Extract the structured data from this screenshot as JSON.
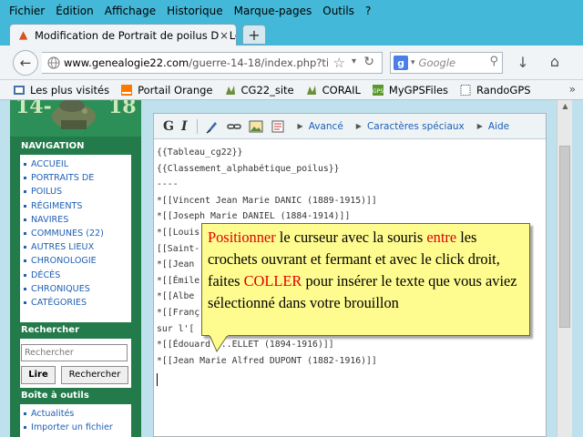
{
  "menu": [
    "Fichier",
    "Édition",
    "Affichage",
    "Historique",
    "Marque-pages",
    "Outils",
    "?"
  ],
  "tab": {
    "title": "Modification de Portrait de poilus D - Le...",
    "close": "×",
    "newtab": "+"
  },
  "nav": {
    "url_domain": "www.genealogie22.com",
    "url_path": "/guerre-14-18/index.php?title=",
    "search_placeholder": "Google"
  },
  "bookmarks": [
    {
      "label": "Les plus visités",
      "icon": "bookmarks-icon"
    },
    {
      "label": "Portail Orange",
      "icon": "orange-icon"
    },
    {
      "label": "CG22_site",
      "icon": "cg22-icon"
    },
    {
      "label": "CORAIL",
      "icon": "cg22-icon"
    },
    {
      "label": "MyGPSFiles",
      "icon": "gps-icon"
    },
    {
      "label": "RandoGPS",
      "icon": "page-icon"
    }
  ],
  "logo": {
    "left": "14-",
    "right": "18"
  },
  "sidebar": {
    "nav_title": "NAVIGATION",
    "nav_items": [
      "ACCUEIL",
      "PORTRAITS DE",
      "POILUS",
      "RÉGIMENTS",
      "NAVIRES",
      "COMMUNES (22)",
      "AUTRES LIEUX",
      "CHRONOLOGIE",
      "DÉCÈS",
      "CHRONIQUES",
      "CATÉGORIES"
    ],
    "search_title": "Rechercher",
    "search_placeholder": "Rechercher",
    "search_go": "Lire",
    "search_btn": "Rechercher",
    "tools_title": "Boîte à outils",
    "tools_items": [
      "Actualités",
      "Importer un fichier"
    ]
  },
  "editor": {
    "toolbar": {
      "bold": "G",
      "italic": "I",
      "advanced": "Avancé",
      "special": "Caractères spéciaux",
      "help": "Aide"
    },
    "lines": [
      "{{Tableau_cg22}}",
      "{{Classement_alphabétique_poilus}}",
      "----",
      "*[[Vincent Jean Marie DANIC (1889-1915)]]",
      "*[[Joseph Marie DANIEL (1884-1914)]]",
      "*[[Louis",
      "[[Saint-",
      "*[[Jean",
      "*[[Émile",
      "*[[Albe",
      "*[[Franç",
      "sur l'[",
      "*[[Édouard ...ELLET (1894-1916)]]",
      "*[[Jean Marie Alfred DUPONT (1882-1916)]]"
    ]
  },
  "callout": {
    "p1": "Positionner",
    "p2": " le curseur avec la souris ",
    "p3": "entre",
    "p4": " les crochets ouvrant et fermant et avec le click droit, faites ",
    "p5": "COLLER",
    "p6": " pour insérer le texte que vous aviez sélectionné dans votre brouillon"
  }
}
